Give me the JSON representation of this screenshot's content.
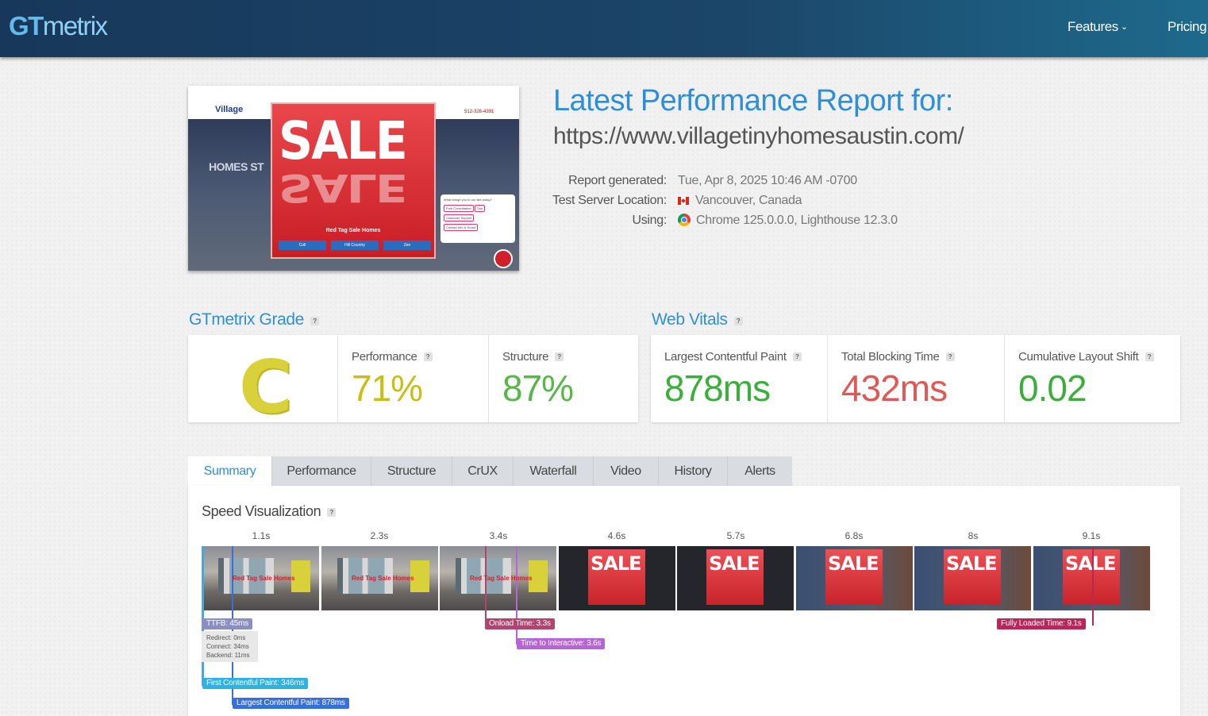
{
  "header": {
    "logo_gt": "GT",
    "logo_rest": "metrix",
    "nav": {
      "features": "Features",
      "features_chev": "⌄",
      "pricing": "Pricing"
    }
  },
  "screenshot": {
    "brand": "Village",
    "phone": "512-326-4391",
    "hero_text": "HOMES ST",
    "sale": "SALE",
    "red_tag": "Red Tag Sale Homes",
    "buttons": [
      "Coll",
      "Hill Country",
      "Zen"
    ],
    "chat_question": "What brings you to our site today?",
    "chat_options": [
      "Free Consultation",
      "Tour",
      "Customer Support",
      "Contact Info & Hours"
    ],
    "close": "×"
  },
  "report": {
    "title": "Latest Performance Report for:",
    "url": "https://www.villagetinyhomesaustin.com/",
    "generated_label": "Report generated:",
    "generated_value": "Tue, Apr 8, 2025 10:46 AM -0700",
    "location_label": "Test Server Location:",
    "location_value": "Vancouver, Canada",
    "using_label": "Using:",
    "using_value": "Chrome 125.0.0.0, Lighthouse 12.3.0"
  },
  "grade": {
    "section_title": "GTmetrix Grade",
    "letter": "C",
    "performance_label": "Performance",
    "performance_value": "71%",
    "structure_label": "Structure",
    "structure_value": "87%"
  },
  "vitals": {
    "section_title": "Web Vitals",
    "lcp_label": "Largest Contentful Paint",
    "lcp_value": "878ms",
    "tbt_label": "Total Blocking Time",
    "tbt_value": "432ms",
    "cls_label": "Cumulative Layout Shift",
    "cls_value": "0.02"
  },
  "colors": {
    "accent": "#2f8fd6",
    "grade_c": "#d9d13a",
    "perf": "#c9bd16",
    "good": "#3cae3c",
    "bad": "#e05a55"
  },
  "tabs": [
    "Summary",
    "Performance",
    "Structure",
    "CrUX",
    "Waterfall",
    "Video",
    "History",
    "Alerts"
  ],
  "speed": {
    "title": "Speed Visualization",
    "help": "?",
    "times": [
      "1.1s",
      "2.3s",
      "3.4s",
      "4.6s",
      "5.7s",
      "6.8s",
      "8s",
      "9.1s"
    ],
    "porch_text": "Red Tag Sale Homes",
    "frame_sale": "SALE",
    "ttfb": "TTFB: 45ms",
    "ttfb_redirect": "Redirect: 0ms",
    "ttfb_connect": "Connect: 34ms",
    "ttfb_backend": "Backend: 11ms",
    "onload": "Onload Time: 3.3s",
    "tti": "Time to Interactive: 3.6s",
    "fully_loaded": "Fully Loaded Time: 9.1s",
    "fcp": "First Contentful Paint: 346ms",
    "lcp": "Largest Contentful Paint: 878ms"
  }
}
